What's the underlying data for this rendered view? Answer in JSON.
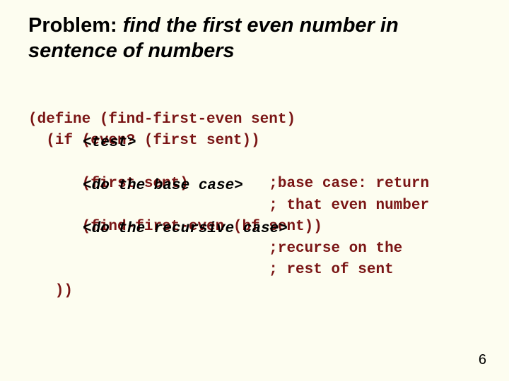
{
  "title": {
    "roman": "Problem: ",
    "italic": "find the first even number in sentence of numbers"
  },
  "code": {
    "l1": "(define (find-first-even sent)",
    "l2a": "  (if ",
    "l2b": "(even? (first sent))",
    "l2_ov": "<test>",
    "l4a": "      ",
    "l4b": "(first sent)",
    "l4c": "         ;base case: return",
    "l4_ov": "<do the base case>",
    "l5": "                           ; that even number",
    "l6a": "      ",
    "l6b": "(find-first-even (bf sent))",
    "l6_ov": "<do the recursive case>",
    "l7": "                           ;recurse on the",
    "l8": "                           ; rest of sent",
    "l9": "   ))"
  },
  "pagenum": "6"
}
